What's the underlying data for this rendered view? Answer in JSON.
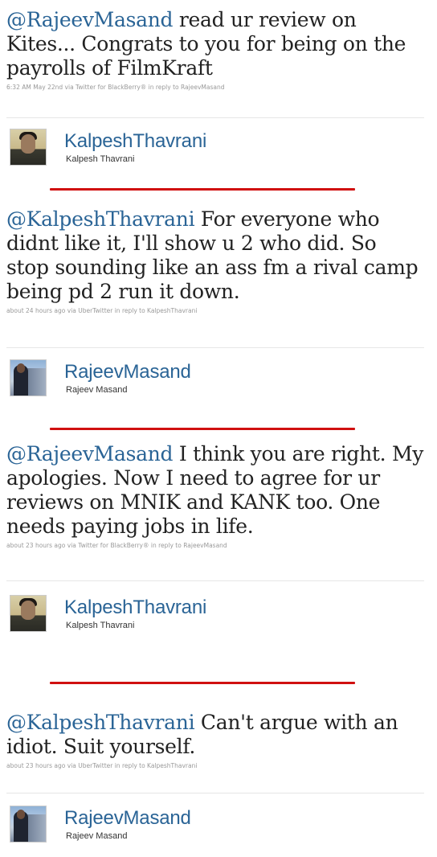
{
  "tweets": [
    {
      "mention": "@RajeevMasand",
      "text": " read ur review on Kites... Congrats to you for being on the payrolls of FilmKraft",
      "meta": "6:32 AM May 22nd via Twitter for BlackBerry® in reply to RajeevMasand",
      "author_username": "KalpeshThavrani",
      "author_fullname": "Kalpesh Thavrani"
    },
    {
      "mention": "@KalpeshThavrani",
      "text": " For everyone who didnt like it, I'll show u 2 who did. So stop sounding like an ass fm a rival camp being pd 2 run it down.",
      "meta": "about 24 hours ago via UberTwitter in reply to KalpeshThavrani",
      "author_username": "RajeevMasand",
      "author_fullname": "Rajeev Masand"
    },
    {
      "mention": "@RajeevMasand",
      "text": " I think you are right. My apologies. Now I need to agree for ur reviews on MNIK and KANK too. One needs paying jobs in life.",
      "meta": "about 23 hours ago via Twitter for BlackBerry® in reply to RajeevMasand",
      "author_username": "KalpeshThavrani",
      "author_fullname": "Kalpesh Thavrani"
    },
    {
      "mention": "@KalpeshThavrani",
      "text": " Can't argue with an idiot. Suit yourself.",
      "meta": "about 23 hours ago via UberTwitter in reply to KalpeshThavrani",
      "author_username": "RajeevMasand",
      "author_fullname": "Rajeev Masand"
    }
  ],
  "colors": {
    "link": "#2a6496",
    "divider": "#d01010",
    "meta": "#999999"
  }
}
